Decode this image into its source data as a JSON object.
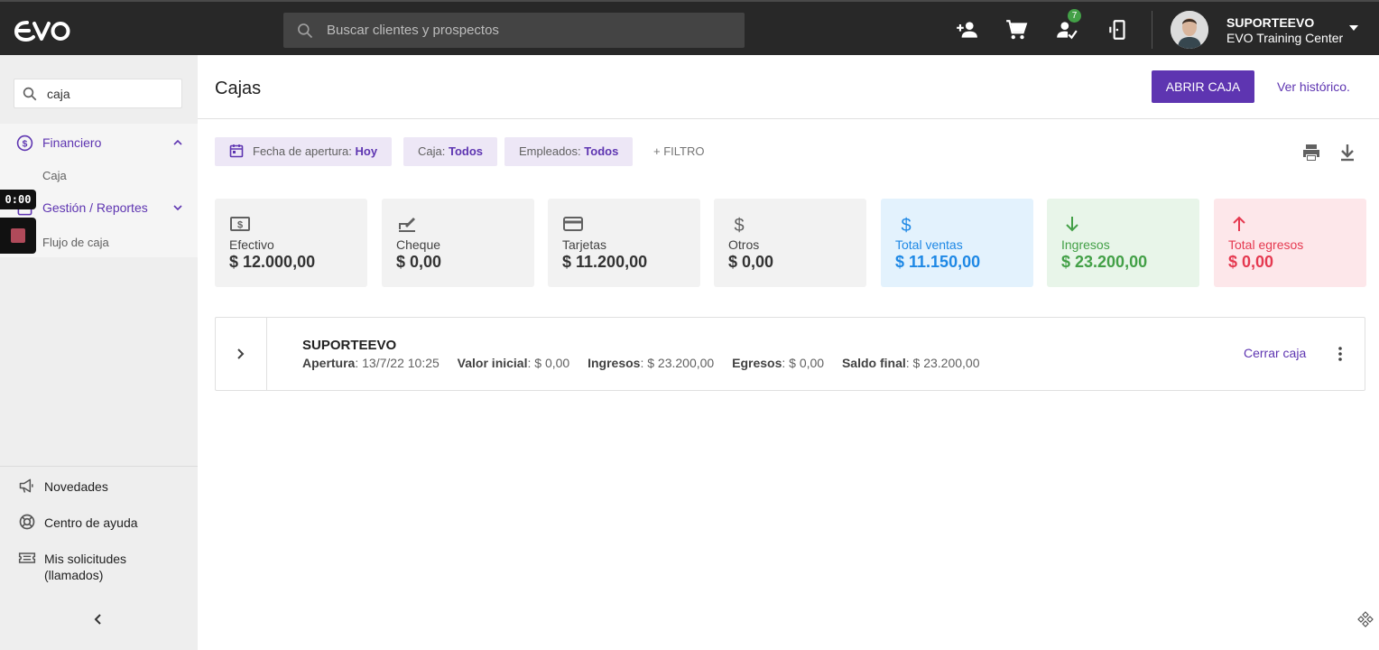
{
  "topbar": {
    "logo": "evo",
    "search_placeholder": "Buscar clientes y prospectos",
    "notifications_badge": "7",
    "user": {
      "name": "SUPORTEEVO",
      "org": "EVO Training Center"
    }
  },
  "sidebar": {
    "search_value": "caja",
    "menu": [
      {
        "label": "Financiero",
        "sub": "Caja"
      },
      {
        "label": "Gestión / Reportes",
        "sub": "Flujo de caja"
      }
    ],
    "timer": "0:00",
    "footer": [
      {
        "label": "Novedades"
      },
      {
        "label": "Centro de ayuda"
      },
      {
        "label": "Mis solicitudes (llamados)"
      }
    ]
  },
  "main": {
    "title": "Cajas",
    "open_button": "ABRIR CAJA",
    "history_link": "Ver histórico.",
    "filters": [
      {
        "key": "Fecha de apertura:",
        "value": "Hoy"
      },
      {
        "key": "Caja:",
        "value": "Todos"
      },
      {
        "key": "Empleados:",
        "value": "Todos"
      }
    ],
    "add_filter": "+ FILTRO",
    "cards": [
      {
        "label": "Efectivo",
        "value": "$ 12.000,00",
        "icon": "cash-icon"
      },
      {
        "label": "Cheque",
        "value": "$ 0,00",
        "icon": "check-icon"
      },
      {
        "label": "Tarjetas",
        "value": "$ 11.200,00",
        "icon": "credit-card-icon"
      },
      {
        "label": "Otros",
        "value": "$ 0,00",
        "icon": "dollar-icon"
      },
      {
        "label": "Total ventas",
        "value": "$ 11.150,00",
        "icon": "dollar-icon",
        "color": "#1e88e5"
      },
      {
        "label": "Ingresos",
        "value": "$ 23.200,00",
        "icon": "arrow-down-icon",
        "color": "#43a047"
      },
      {
        "label": "Total egresos",
        "value": "$ 0,00",
        "icon": "arrow-up-icon",
        "color": "#e53950"
      }
    ],
    "register": {
      "name": "SUPORTEEVO",
      "apertura_label": "Apertura",
      "apertura": "13/7/22 10:25",
      "valor_inicial_label": "Valor inicial",
      "valor_inicial": "$ 0,00",
      "ingresos_label": "Ingresos",
      "ingresos": "$ 23.200,00",
      "egresos_label": "Egresos",
      "egresos": "$ 0,00",
      "saldo_final_label": "Saldo final",
      "saldo_final": "$ 23.200,00",
      "close_link": "Cerrar caja"
    }
  },
  "colors": {
    "accent": "#5e35b1",
    "topbar": "#282828",
    "sidebar": "#eeeeee"
  }
}
